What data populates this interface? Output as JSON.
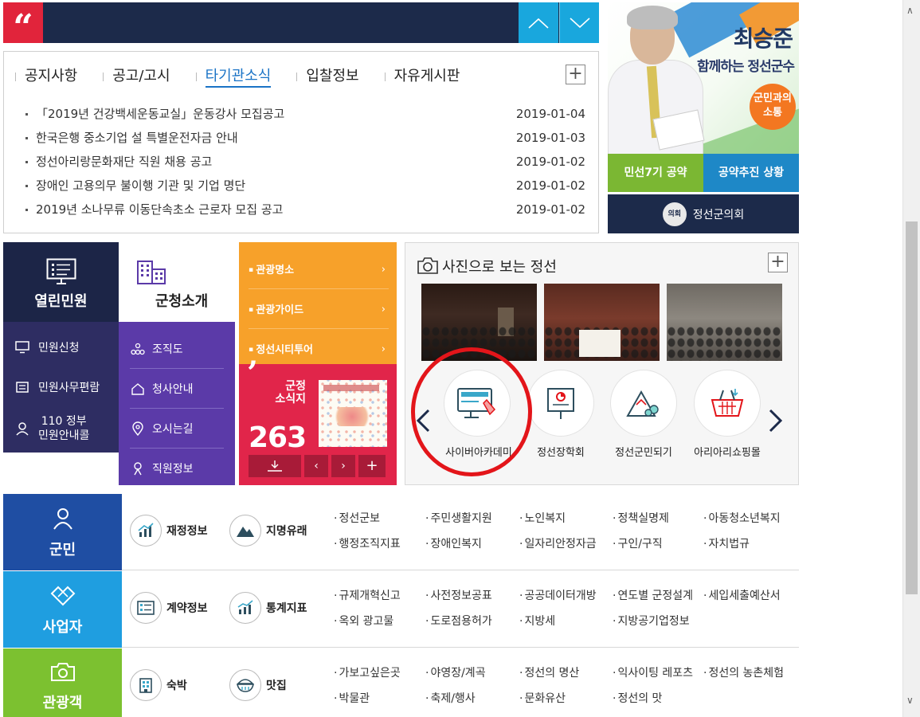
{
  "notice_bar": {
    "quote_mark": "“"
  },
  "board": {
    "tabs": [
      {
        "label": "공지사항"
      },
      {
        "label": "공고/고시"
      },
      {
        "label": "타기관소식"
      },
      {
        "label": "입찰정보"
      },
      {
        "label": "자유게시판"
      }
    ],
    "active_tab": "타기관소식",
    "more_label": "+",
    "items": [
      {
        "title": "「2019년 건강백세운동교실」운동강사 모집공고",
        "date": "2019-01-04"
      },
      {
        "title": "한국은행 중소기업 설 특별운전자금 안내",
        "date": "2019-01-03"
      },
      {
        "title": "정선아리랑문화재단 직원 채용 공고",
        "date": "2019-01-02"
      },
      {
        "title": "장애인 고용의무 불이행 기관 및 기업 명단",
        "date": "2019-01-02"
      },
      {
        "title": "2019년 소나무류 이동단속초소 근로자 모집 공고",
        "date": "2019-01-02"
      }
    ]
  },
  "mayor": {
    "name": "최승준",
    "slogan": "함께하는 정선군수",
    "bubble_line1": "군민과의",
    "bubble_line2": "소통",
    "pledge_label": "민선7기 공약",
    "progress_label": "공약추진 상황",
    "council_label": "정선군의회",
    "council_seal": "의회"
  },
  "civil": {
    "title": "열린민원",
    "items": [
      {
        "label": "민원신청"
      },
      {
        "label": "민원사무편람"
      },
      {
        "label_line1": "110 정부",
        "label_line2": "민원안내콜"
      }
    ]
  },
  "county": {
    "title": "군청소개",
    "items": [
      {
        "label": "조직도"
      },
      {
        "label": "청사안내"
      },
      {
        "label": "오시는길"
      },
      {
        "label": "직원정보"
      }
    ]
  },
  "tour": {
    "links": [
      {
        "label": "관광명소"
      },
      {
        "label": "관광가이드"
      },
      {
        "label": "정선시티투어"
      }
    ],
    "chevron": "›"
  },
  "newsletter": {
    "quote_mark": "’",
    "title_line1": "군정",
    "title_line2": "소식지",
    "issue": "263",
    "download_icon": "download-icon",
    "prev": "‹",
    "next": "›",
    "plus": "+"
  },
  "photo": {
    "title": "사진으로 보는 정선",
    "more_label": "+",
    "links": [
      {
        "label": "사이버아카데미",
        "icon": "monitor-pointer-icon"
      },
      {
        "label": "정선장학회",
        "icon": "presentation-board-icon"
      },
      {
        "label": "정선군민되기",
        "icon": "mountain-people-icon"
      },
      {
        "label": "아리아리쇼핑몰",
        "icon": "shopping-basket-icon"
      }
    ]
  },
  "categories": [
    {
      "title": "군민",
      "color": "#1f4ea3",
      "features": [
        {
          "label": "재정정보"
        },
        {
          "label": "지명유래"
        }
      ],
      "links": [
        "정선군보",
        "주민생활지원",
        "노인복지",
        "정책실명제",
        "아동청소년복지",
        "행정조직지표",
        "장애인복지",
        "일자리안정자금",
        "구인/구직",
        "자치법규"
      ]
    },
    {
      "title": "사업자",
      "color": "#1f9ee0",
      "features": [
        {
          "label": "계약정보"
        },
        {
          "label": "통계지표"
        }
      ],
      "links": [
        "규제개혁신고",
        "사전정보공표",
        "공공데이터개방",
        "연도별 군정설계",
        "세입세출예산서",
        "옥외 광고물",
        "도로점용허가",
        "지방세",
        "지방공기업정보"
      ]
    },
    {
      "title": "관광객",
      "color": "#7cc130",
      "features": [
        {
          "label": "숙박"
        },
        {
          "label": "맛집"
        }
      ],
      "links": [
        "가보고싶은곳",
        "야영장/계곡",
        "정선의 명산",
        "익사이팅 레포츠",
        "정선의 농촌체험",
        "박물관",
        "축제/행사",
        "문화유산",
        "정선의 맛"
      ]
    }
  ]
}
